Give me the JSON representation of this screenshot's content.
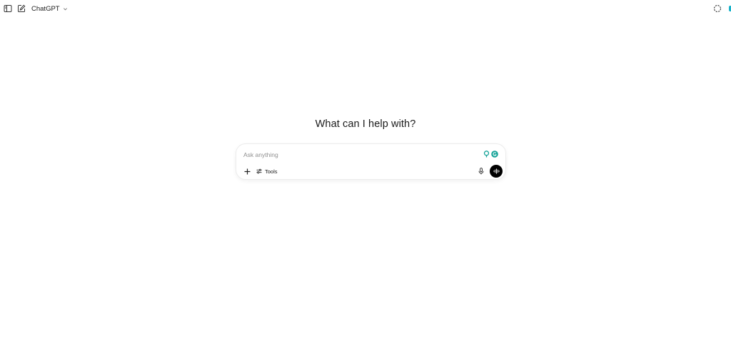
{
  "topbar": {
    "model_name": "ChatGPT",
    "icons": [
      "sidebar-toggle-icon",
      "new-chat-icon",
      "chevron-down-icon",
      "temporary-chat-icon"
    ]
  },
  "main": {
    "heading": "What can I help with?"
  },
  "composer": {
    "placeholder": "Ask anything",
    "input_value": "",
    "tools_label": "Tools",
    "icons": [
      "extension-pin-icon",
      "extension-grammarly-icon",
      "plus-icon",
      "tools-sliders-icon",
      "microphone-icon",
      "voice-mode-icon"
    ]
  },
  "colors": {
    "background": "#ffffff",
    "text": "#0d0d0d",
    "placeholder": "#8f8f8f",
    "voice_button": "#000000",
    "extension_accent": "#15a398",
    "edge_accent": "#19b2c9"
  }
}
